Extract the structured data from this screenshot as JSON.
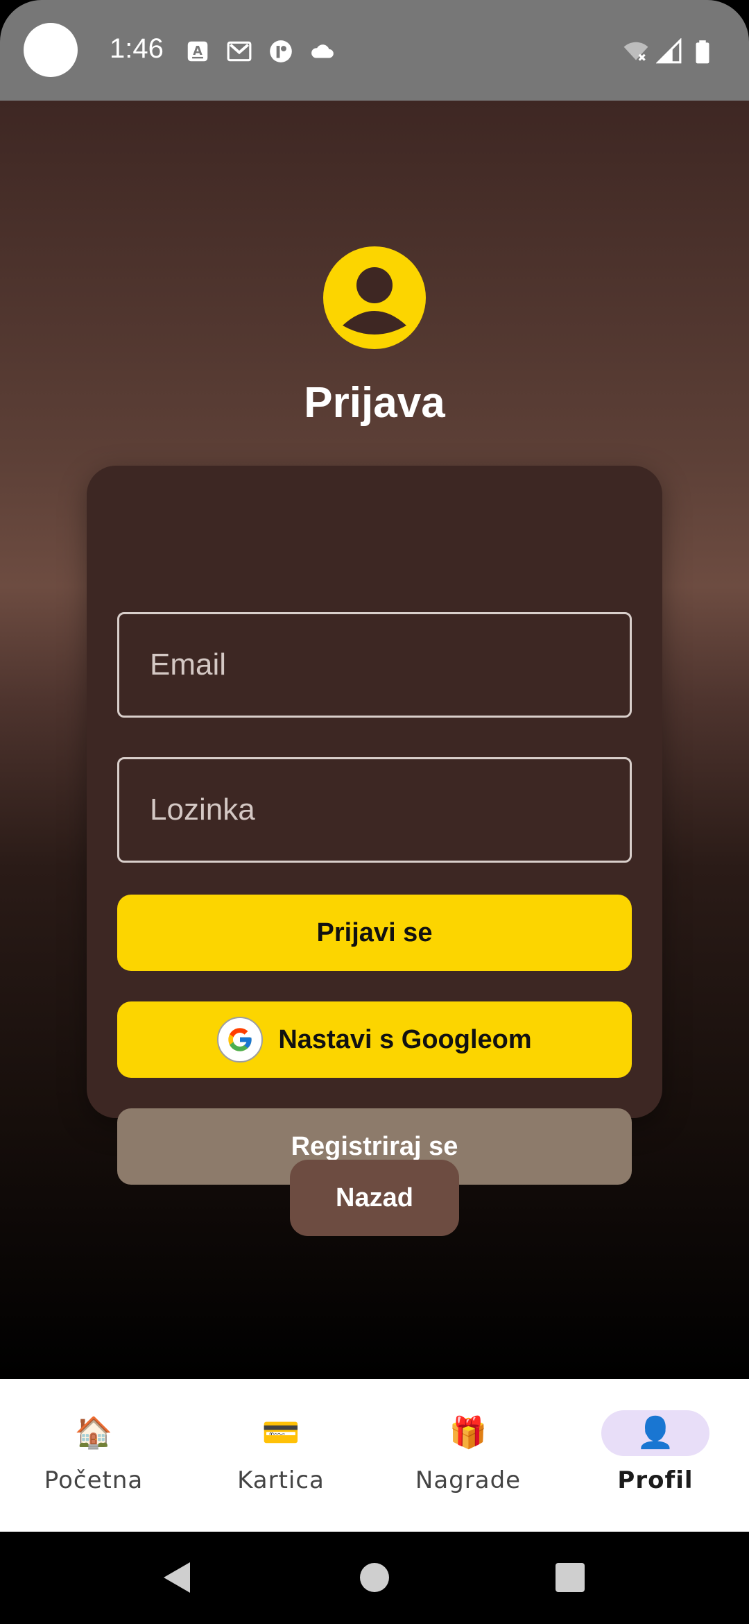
{
  "status_bar": {
    "time": "1:46",
    "icons_left": [
      "translate-icon",
      "gmail-icon",
      "app-icon",
      "cloud-icon"
    ],
    "icons_right": [
      "wifi-off-icon",
      "signal-icon",
      "battery-icon"
    ]
  },
  "login": {
    "title": "Prijava",
    "email_placeholder": "Email",
    "password_placeholder": "Lozinka",
    "login_button": "Prijavi se",
    "google_button": "Nastavi s Googleom",
    "register_button": "Registriraj se",
    "back_button": "Nazad"
  },
  "bottom_nav": {
    "items": [
      {
        "label": "Početna",
        "icon": "🏠",
        "active": false
      },
      {
        "label": "Kartica",
        "icon": "💳",
        "active": false
      },
      {
        "label": "Nagrade",
        "icon": "🎁",
        "active": false
      },
      {
        "label": "Profil",
        "icon": "👤",
        "active": true
      }
    ]
  },
  "colors": {
    "accent_yellow": "#fcd500",
    "card_bg": "#3d2723",
    "register_bg": "#8d7b6b",
    "back_bg": "#6d4c41",
    "nav_active_pill": "#e8def8"
  }
}
